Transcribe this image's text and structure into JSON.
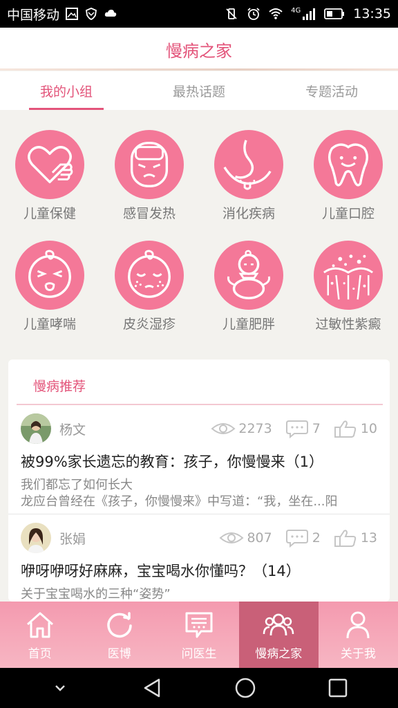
{
  "status_bar": {
    "carrier": "中国移动",
    "network": "4G",
    "time": "13:35"
  },
  "header": {
    "title": "慢病之家"
  },
  "tabs": [
    {
      "label": "我的小组",
      "active": true
    },
    {
      "label": "最热话题",
      "active": false
    },
    {
      "label": "专题活动",
      "active": false
    }
  ],
  "categories": [
    {
      "label": "儿童保健",
      "icon": "heart-hand-icon"
    },
    {
      "label": "感冒发热",
      "icon": "sick-baby-icon"
    },
    {
      "label": "消化疾病",
      "icon": "stomach-icon"
    },
    {
      "label": "儿童口腔",
      "icon": "tooth-icon"
    },
    {
      "label": "儿童哮喘",
      "icon": "coughing-baby-icon"
    },
    {
      "label": "皮炎湿疹",
      "icon": "rash-baby-icon"
    },
    {
      "label": "儿童肥胖",
      "icon": "chubby-baby-icon"
    },
    {
      "label": "过敏性紫癜",
      "icon": "skin-spots-icon"
    }
  ],
  "recommend": {
    "title": "慢病推荐",
    "posts": [
      {
        "author": "杨文",
        "views": "2273",
        "comments": "7",
        "likes": "10",
        "title": "被99%家长遗忘的教育：孩子，你慢慢来（1）",
        "summary_line1": "我们都忘了如何长大",
        "summary_line2": "龙应台曾经在《孩子，你慢慢来》中写道：“我，坐在...阳"
      },
      {
        "author": "张娟",
        "views": "807",
        "comments": "2",
        "likes": "13",
        "title": "咿呀咿呀好麻麻，宝宝喝水你懂吗？（14）",
        "summary_line1": "关于宝宝喝水的三种“姿势”",
        "summary_line2": ""
      }
    ]
  },
  "bottom_nav": [
    {
      "label": "首页",
      "icon": "home-icon",
      "active": false
    },
    {
      "label": "医博",
      "icon": "refresh-icon",
      "active": false
    },
    {
      "label": "问医生",
      "icon": "chat-icon",
      "active": false
    },
    {
      "label": "慢病之家",
      "icon": "group-icon",
      "active": true
    },
    {
      "label": "关于我",
      "icon": "person-icon",
      "active": false
    }
  ],
  "colors": {
    "accent": "#e3547a",
    "icon_circle": "#f47898",
    "nav_bg": "#f7a3b4",
    "nav_active": "#c96078"
  }
}
